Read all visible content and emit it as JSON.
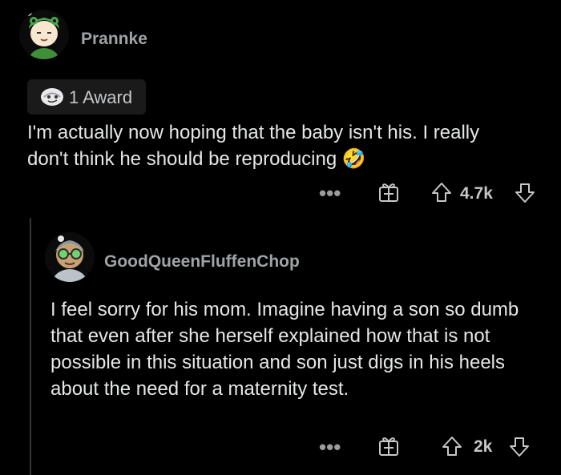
{
  "comments": [
    {
      "username": "Prannke",
      "award_label": "1 Award",
      "body": "I'm actually now hoping that the baby isn't his. I really don't think he should be reproducing 🤣",
      "votes": "4.7k",
      "icons": [
        "more-dots-icon",
        "gift-award-icon",
        "upvote-arrow-icon",
        "downvote-arrow-icon"
      ]
    },
    {
      "username": "GoodQueenFluffenChop",
      "body": "I feel sorry for his mom. Imagine having a son so dumb that even after she herself explained how that is not possible in this situation and son just digs in his heels about the need for a maternity test.",
      "votes": "2k",
      "icons": [
        "more-dots-icon",
        "gift-award-icon",
        "upvote-arrow-icon",
        "downvote-arrow-icon"
      ]
    }
  ],
  "colors": {
    "background": "#000000",
    "text": "#e4e6e8",
    "muted": "#a0a3a6",
    "thread_line": "#343536",
    "avatar_green": "#46a34a"
  }
}
